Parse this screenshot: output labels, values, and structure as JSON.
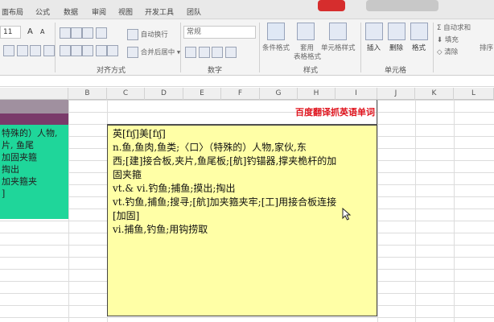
{
  "tabs": [
    "面布局",
    "公式",
    "数据",
    "审阅",
    "视图",
    "开发工具",
    "团队"
  ],
  "font": {
    "size": "11",
    "grow": "A",
    "shrink": "A"
  },
  "ribbon": {
    "wrap_text": "自动换行",
    "merge_center": "合并后居中",
    "number_format": "常规",
    "conditional_format": "条件格式",
    "table_format_top": "套用",
    "table_format_bottom": "表格格式",
    "cell_style": "单元格样式",
    "insert": "插入",
    "delete": "删除",
    "format": "格式",
    "autosum": "自动求和",
    "fill": "填充",
    "clear": "清除",
    "sort": "排序",
    "groups": {
      "alignment": "对齐方式",
      "number": "数字",
      "styles": "样式",
      "cells": "单元格"
    }
  },
  "columns": [
    "B",
    "C",
    "D",
    "E",
    "F",
    "G",
    "H",
    "I",
    "J",
    "K",
    "L"
  ],
  "title": "百度翻译抓英语单词",
  "green_cell": [
    "特殊的）人物,",
    "片, 鱼尾",
    "加固夹箍",
    "掏出",
    "加夹箍夹",
    "]"
  ],
  "tooltip": [
    "英[fɪʃ]美[fɪʃ]",
    "n.鱼,鱼肉,鱼类;〈口〉（特殊的）人物,家伙,东",
    "西;[建]接合板,夹片,鱼尾板;[航]钓锚器,撑夹桅杆的加",
    "固夹箍",
    "vt.& vi.钓鱼;捕鱼;摸出;掏出",
    "vt.钓鱼,捕鱼;搜寻;[航]加夹箍夹牢;[工]用接合板连接",
    "[加固]",
    "vi.捕鱼,钓鱼;用钩捞取"
  ],
  "colors": {
    "title_red": "#e0141e",
    "tooltip_bg": "#ffffa6",
    "green": "#1fd69a",
    "header_purple": "#7a3a6a"
  }
}
